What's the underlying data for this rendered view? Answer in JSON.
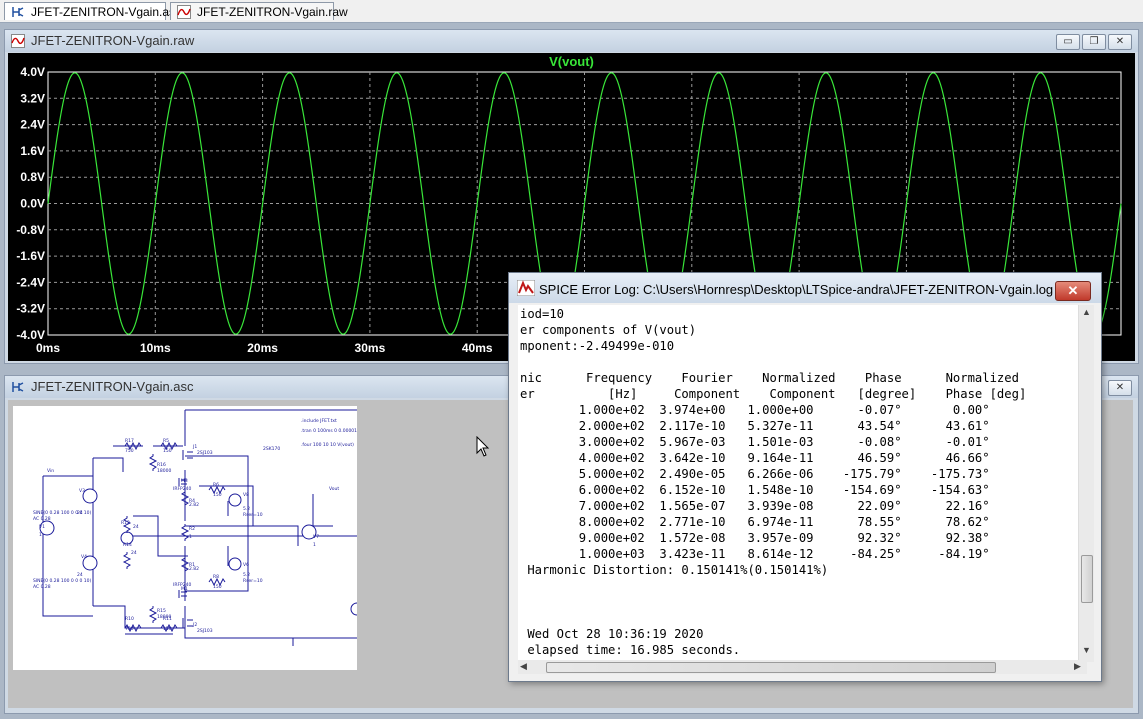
{
  "tabs": [
    {
      "label": "JFET-ZENITRON-Vgain.asc"
    },
    {
      "label": "JFET-ZENITRON-Vgain.raw"
    }
  ],
  "raw_window": {
    "title": "JFET-ZENITRON-Vgain.raw",
    "plot_title": "V(vout)",
    "trace_color": "#39e639",
    "axis_color": "#ffffff",
    "background": "#000000"
  },
  "asc_window": {
    "title": "JFET-ZENITRON-Vgain.asc"
  },
  "chart_data": {
    "type": "line",
    "title": "V(vout)",
    "xlabel": "",
    "ylabel": "",
    "x_ticks": [
      "0ms",
      "10ms",
      "20ms",
      "30ms",
      "40ms"
    ],
    "y_ticks": [
      "4.0V",
      "3.2V",
      "2.4V",
      "1.6V",
      "0.8V",
      "0.0V",
      "-0.8V",
      "-1.6V",
      "-2.4V",
      "-3.2V",
      "-4.0V"
    ],
    "ylim": [
      -4.0,
      4.0
    ],
    "xlim_ms": [
      0,
      100
    ],
    "grid": true,
    "series": [
      {
        "name": "V(vout)",
        "waveform": "sine",
        "amplitude_v": 3.974,
        "frequency_hz": 100,
        "phase_deg": -0.07,
        "duration_ms": 100
      }
    ]
  },
  "log": {
    "title": "SPICE Error Log: C:\\Users\\Hornresp\\Desktop\\LTSpice-andra\\JFET-ZENITRON-Vgain.log",
    "close_label": "✕",
    "lines": [
      "iod=10",
      "er components of V(vout)",
      "mponent:-2.49499e-010",
      "",
      "nic      Frequency    Fourier    Normalized    Phase      Normalized",
      "er          [Hz]     Component    Component   [degree]    Phase [deg]",
      "        1.000e+02  3.974e+00   1.000e+00      -0.07°       0.00°",
      "        2.000e+02  2.117e-10   5.327e-11      43.54°      43.61°",
      "        3.000e+02  5.967e-03   1.501e-03      -0.08°      -0.01°",
      "        4.000e+02  3.642e-10   9.164e-11      46.59°      46.66°",
      "        5.000e+02  2.490e-05   6.266e-06    -175.79°    -175.73°",
      "        6.000e+02  6.152e-10   1.548e-10    -154.69°    -154.63°",
      "        7.000e+02  1.565e-07   3.939e-08      22.09°      22.16°",
      "        8.000e+02  2.771e-10   6.974e-11      78.55°      78.62°",
      "        9.000e+02  1.572e-08   3.957e-09      92.32°      92.38°",
      "        1.000e+03  3.423e-11   8.614e-12     -84.25°     -84.19°",
      " Harmonic Distortion: 0.150141%(0.150141%)",
      "",
      "",
      "",
      " Wed Oct 28 10:36:19 2020",
      " elapsed time: 16.985 seconds."
    ]
  },
  "schematic_labels": {
    "comp_names": [
      "R17",
      "R5",
      "R9",
      "R16",
      "J1",
      "M3",
      "R6",
      "R4",
      "R2",
      "V8",
      "V3",
      "R13",
      "R14",
      "R12",
      "R3",
      "R1",
      "V1",
      "V4",
      "R7",
      "V6",
      "M1",
      "R10",
      "R8",
      "R15",
      "R11",
      "J2",
      "V2",
      "V5",
      "V7"
    ],
    "values": [
      "750",
      "150",
      "18000",
      "IRFP240",
      "150",
      "2.82",
      "IRFP240",
      "1",
      "150",
      "5.2",
      "Rser=10",
      "2SJ103",
      "2SK170",
      "Vout",
      "24",
      "AC 0.28",
      "SINE(0 0.28 100 0 0 0 10)"
    ],
    "directives": [
      ".include JFET.txt",
      ".tran 0 100ms 0 0.0000183677ms",
      ".four 100 10 10 V(vout)"
    ]
  }
}
